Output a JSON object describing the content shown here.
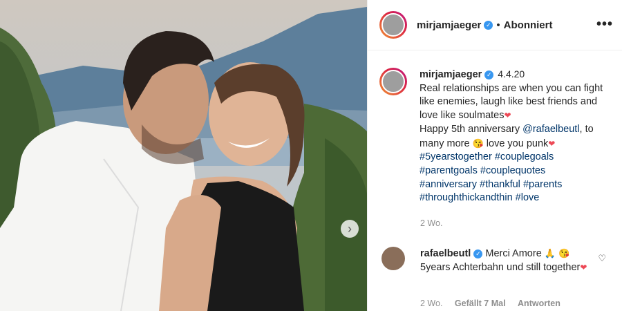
{
  "post": {
    "username": "mirjamjaeger",
    "follow_status": "Abonniert",
    "more_label": "•••",
    "caption": {
      "username": "mirjamjaeger",
      "date": "4.4.20",
      "line1": "Real relationships are when you can fight like enemies, laugh like best friends and love like soulmates",
      "line2a": "Happy 5th anniversary",
      "mention": "@rafaelbeutl",
      "line2b": ", to many more",
      "line2c": "love you punk",
      "hashtags": [
        "#5yearstogether",
        "#couplegoals",
        "#parentgoals",
        "#couplequotes",
        "#anniversary",
        "#thankful",
        "#parents",
        "#throughthickandthin",
        "#love"
      ]
    },
    "age": "2 Wo."
  },
  "comment": {
    "username": "rafaelbeutl",
    "text_a": "Merci Amore",
    "text_b": "5years Achterbahn und still together",
    "age": "2 Wo.",
    "likes": "Gefällt 7 Mal",
    "reply": "Antworten"
  },
  "icons": {
    "verified": "✓",
    "heart_outline": "♡",
    "red_heart": "❤",
    "chevron_right": "›",
    "kiss_emoji": "😘",
    "prayer_emoji": "🙏"
  },
  "colors": {
    "verified": "#3897f0",
    "hashtag": "#003569",
    "meta": "#8e8e8e"
  }
}
